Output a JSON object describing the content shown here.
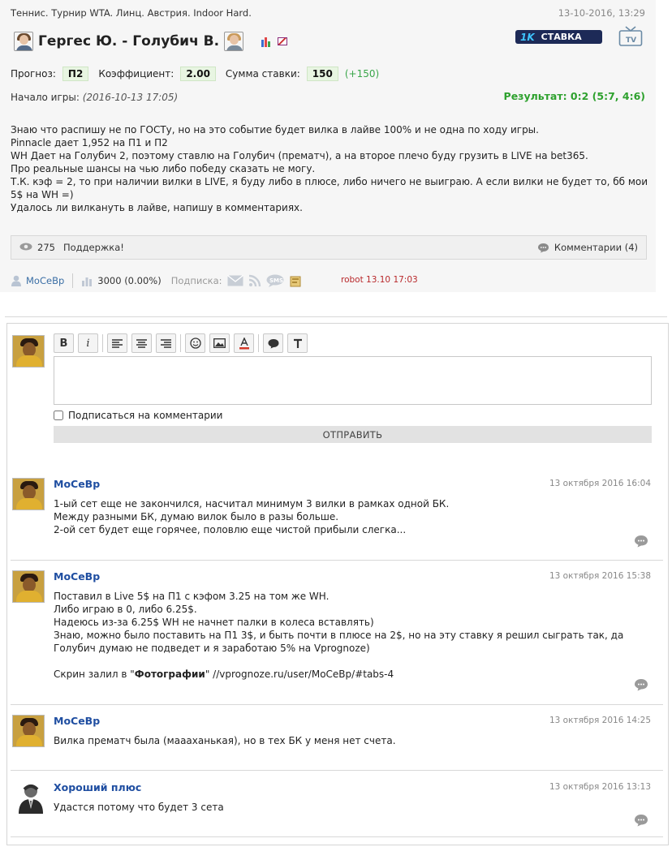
{
  "header": {
    "breadcrumb": "Теннис. Турнир WTA. Линц. Австрия. Indoor Hard.",
    "datetime": "13-10-2016, 13:29",
    "title": "Гергес Ю. - Голубич В.",
    "stavka_k": "1K",
    "stavka_label": "СТАВКА",
    "tv_label": "TV"
  },
  "forecast": {
    "prognoz_label": "Прогноз:",
    "prognoz_value": "П2",
    "coef_label": "Коэффициент:",
    "coef_value": "2.00",
    "sum_label": "Сумма ставки:",
    "sum_value": "150",
    "profit": "(+150)",
    "start_label": "Начало игры:",
    "start_value": "(2016-10-13 17:05)",
    "result": "Результат: 0:2 (5:7, 4:6)"
  },
  "description": [
    "Знаю что распишу не по ГОСТу, но на это событие будет вилка в лайве 100% и не одна по ходу игры.",
    "Pinnacle дает 1,952 на П1 и П2",
    "WH Дает на Голубич 2, поэтому ставлю на Голубич (прематч), а на второе плечо буду грузить в LIVE на bet365.",
    "Про реальные шансы на чью либо победу сказать не могу.",
    "Т.К. кэф = 2, то при наличии вилки в LIVE, я буду либо в плюсе, либо ничего не выиграю. А если вилки не будет то, бб мои 5$ на WH =)",
    "Удалось ли вилкануть в лайве, напишу в комментариях."
  ],
  "stats_bar": {
    "views": "275",
    "support": "Поддержка!",
    "comments": "Комментарии (4)"
  },
  "meta": {
    "author": "МоСеВр",
    "bank": "3000 (0.00%)",
    "subscribe_label": "Подписка:",
    "robot": "robot 13.10 17:03"
  },
  "editor": {
    "subscribe_label": "Подписаться на комментарии",
    "send_label": "ОТПРАВИТЬ"
  },
  "comments": [
    {
      "name": "МоСеВр",
      "date": "13 октября 2016 16:04",
      "lines": [
        "1-ый сет еще не закончился, насчитал минимум 3 вилки в рамках одной БК.",
        "Между разными БК, думаю вилок было в разы больше.",
        "2-ой сет будет еще горячее, половлю еще чистой прибыли слегка..."
      ]
    },
    {
      "name": "МоСеВр",
      "date": "13 октября 2016 15:38",
      "lines": [
        "Поставил в Live 5$ на П1 с кэфом 3.25 на том же WH.",
        "Либо играю в 0, либо 6.25$.",
        "Надеюсь из-за 6.25$ WH не начнет палки в колеса вставлять)",
        "Знаю, можно было поставить на П1 3$, и быть почти в плюсе на 2$, но на эту ставку я решил сыграть так, да Голубич думаю не подведет и я заработаю 5% на Vprognoze)"
      ],
      "link_prefix": "Скрин залил в \"",
      "link_bold": "Фотографии",
      "link_suffix": "\" //vprognoze.ru/user/МоСеВр/#tabs-4"
    },
    {
      "name": "МоСеВр",
      "date": "13 октября 2016 14:25",
      "lines": [
        "Вилка прематч была (маааханькая), но в тех БК у меня нет счета."
      ]
    },
    {
      "name": "Хороший плюс",
      "date": "13 октября 2016 13:13",
      "lines": [
        "Удастся потому что будет 3 сета"
      ]
    }
  ]
}
